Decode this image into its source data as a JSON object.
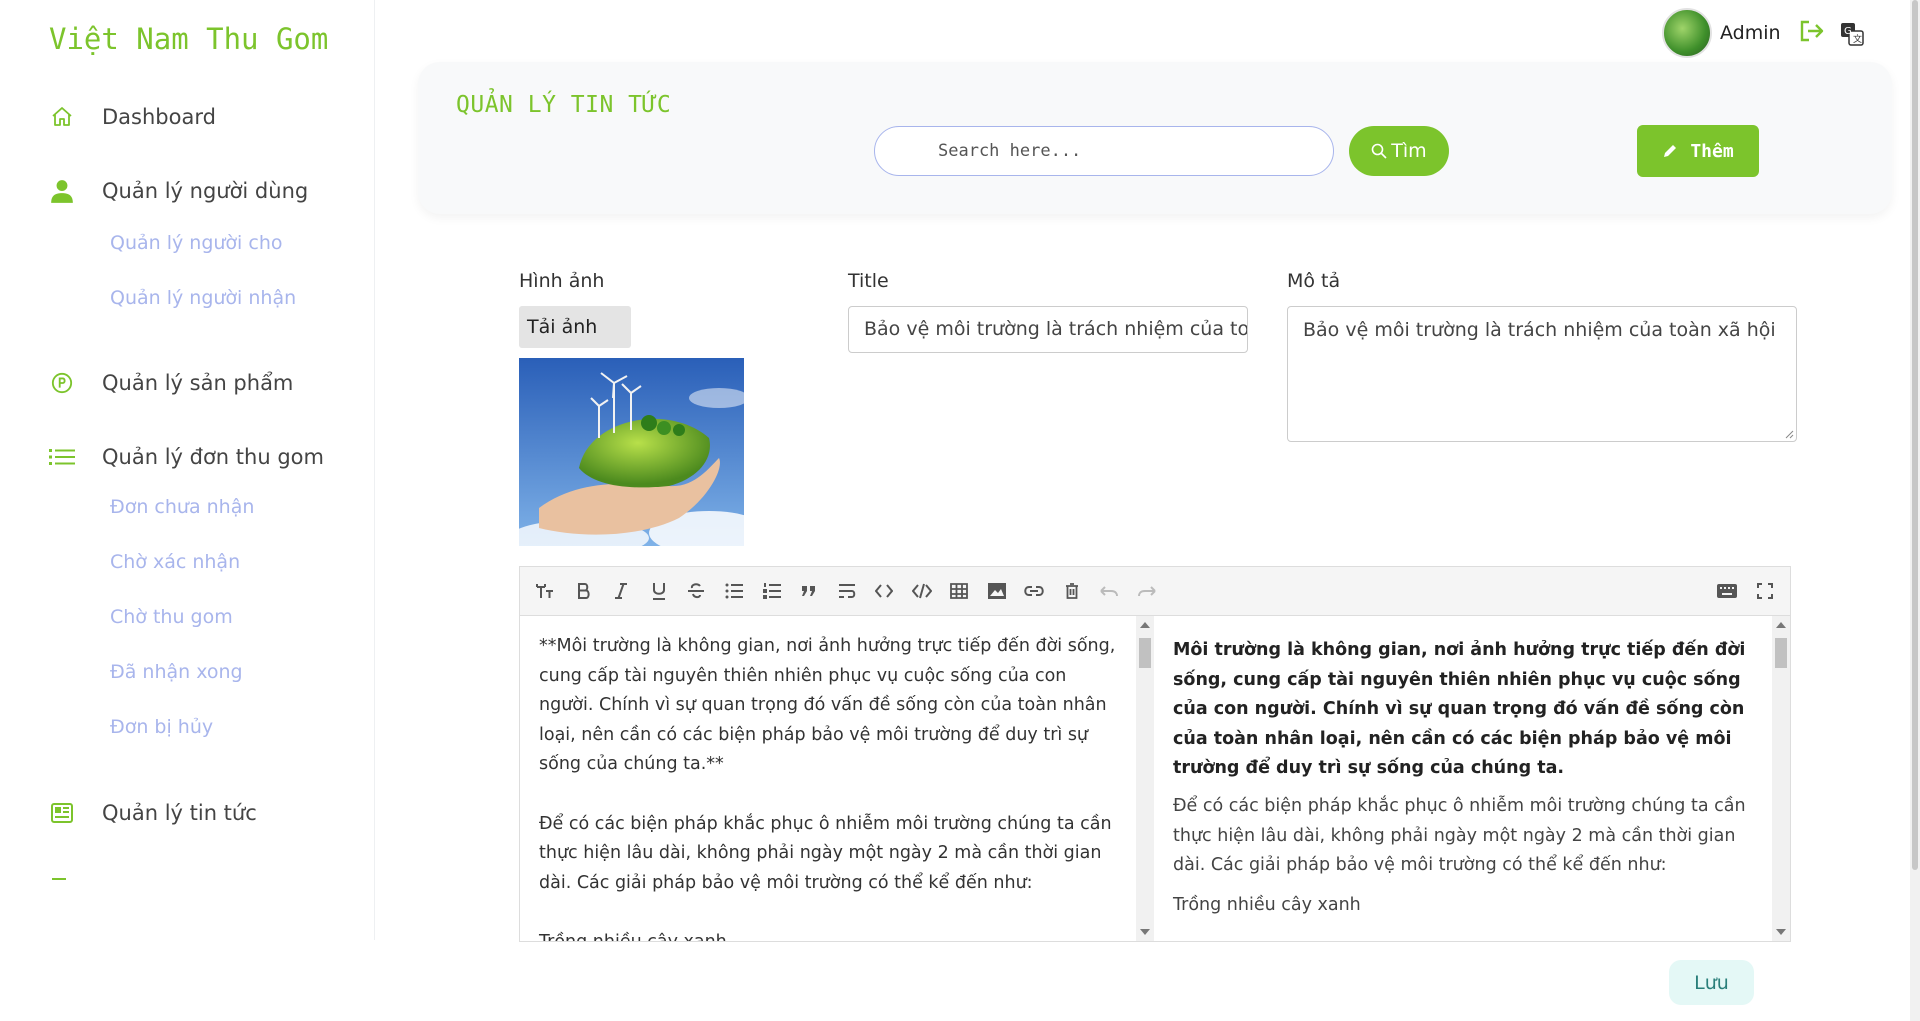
{
  "brand": "Việt Nam Thu Gom",
  "sidebar": {
    "items": [
      {
        "label": "Dashboard",
        "icon": "home-icon"
      },
      {
        "label": "Quản lý người dùng",
        "icon": "user-icon"
      },
      {
        "label": "Quản lý sản phẩm",
        "icon": "product-icon"
      },
      {
        "label": "Quản lý đơn thu gom",
        "icon": "list-icon"
      },
      {
        "label": "Quản lý tin tức",
        "icon": "news-icon"
      }
    ],
    "user_sub": [
      "Quản lý người cho",
      "Quản lý người nhận"
    ],
    "order_sub": [
      "Đơn chưa nhận",
      "Chờ xác nhận",
      "Chờ thu gom",
      "Đã nhận xong",
      "Đơn bị hủy"
    ]
  },
  "topbar": {
    "user_name": "Admin"
  },
  "header": {
    "title": "QUẢN LÝ TIN TỨC",
    "search_placeholder": "Search here...",
    "search_button": "Tìm",
    "add_button": "Thêm"
  },
  "form": {
    "image_label": "Hình ảnh",
    "upload_button": "Tải ảnh",
    "title_label": "Title",
    "title_value": "Bảo vệ môi trường là trách nhiệm của toàn xã hội",
    "desc_label": "Mô tả",
    "desc_value": "Bảo vệ môi trường là trách nhiệm của toàn xã hội"
  },
  "editor": {
    "markdown_p1": "**Môi trường là không gian, nơi ảnh hưởng trực tiếp đến đời sống, cung cấp tài nguyên thiên nhiên phục vụ cuộc sống của con người. Chính vì sự quan trọng đó vấn đề sống còn của toàn nhân loại, nên cần có các biện pháp bảo vệ môi trường để duy trì sự sống của chúng ta.**",
    "markdown_p2": "Để có các biện pháp khắc phục ô nhiễm môi trường chúng ta cần thực hiện lâu dài, không phải ngày một ngày 2 mà cần thời gian dài. Các giải pháp bảo vệ môi trường có thể kể đến như:",
    "markdown_p3": "Trồng nhiều cây xanh",
    "preview_p1": "Môi trường là không gian, nơi ảnh hưởng trực tiếp đến đời sống, cung cấp tài nguyên thiên nhiên phục vụ cuộc sống của con người. Chính vì sự quan trọng đó vấn đề sống còn của toàn nhân loại, nên cần có các biện pháp bảo vệ môi trường để duy trì sự sống của chúng ta.",
    "preview_p2": "Để có các biện pháp khắc phục ô nhiễm môi trường chúng ta cần thực hiện lâu dài, không phải ngày một ngày 2 mà cần thời gian dài. Các giải pháp bảo vệ môi trường có thể kể đến như:",
    "preview_p3": "Trồng nhiều cây xanh"
  },
  "save_button": "Lưu",
  "colors": {
    "accent": "#7cc42c",
    "sub_link": "#a8b5ec",
    "save_bg": "#e4f8f6"
  }
}
